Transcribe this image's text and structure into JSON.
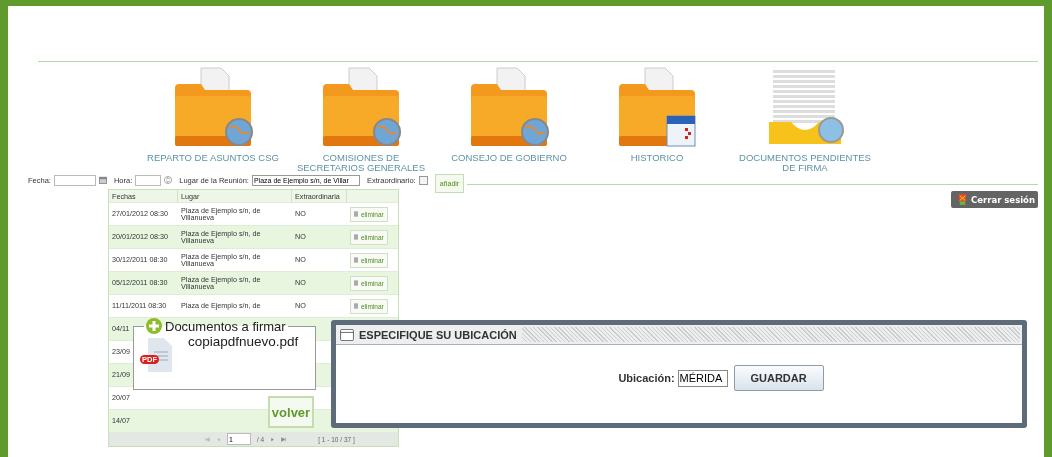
{
  "nav": [
    {
      "label": "REPARTO DE ASUNTOS CSG"
    },
    {
      "label": "COMISIONES DE SECRETARIOS GENERALES"
    },
    {
      "label": "CONSEJO DE GOBIERNO"
    },
    {
      "label": "HISTORICO"
    },
    {
      "label": "DOCUMENTOS PENDIENTES DE FIRMA"
    }
  ],
  "form": {
    "fecha_label": "Fecha:",
    "hora_label": "Hora:",
    "lugar_label": "Lugar de la Reunión:",
    "lugar_value": "Plaza de Ejemplo s/n, de Villar",
    "extra_label": "Extraordinario:",
    "extra_checked": false,
    "add_button": "añadir"
  },
  "logout_button": "Cerrar sesión",
  "table": {
    "columns": [
      "Fechas",
      "Lugar",
      "Extraordinaria"
    ],
    "rows": [
      {
        "date": "27/01/2012 08:30",
        "place": "Plaza de Ejemplo s/n, de Villanueva",
        "extra": "NO",
        "action": "eliminar"
      },
      {
        "date": "20/01/2012 08:30",
        "place": "Plaza de Ejemplo s/n, de Villanueva",
        "extra": "NO",
        "action": "eliminar"
      },
      {
        "date": "30/12/2011 08:30",
        "place": "Plaza de Ejemplo s/n, de Villanueva",
        "extra": "NO",
        "action": "eliminar"
      },
      {
        "date": "05/12/2011 08:30",
        "place": "Plaza de Ejemplo s/n, de Villanueva",
        "extra": "NO",
        "action": "eliminar"
      },
      {
        "date": "11/11/2011 08:30",
        "place": "Plaza de Ejemplo s/n, de",
        "extra": "NO",
        "action": "eliminar"
      },
      {
        "date": "04/11"
      },
      {
        "date": "23/09"
      },
      {
        "date": "21/09"
      },
      {
        "date": "20/07"
      },
      {
        "date": "14/07"
      }
    ]
  },
  "pagination": {
    "page": "1",
    "total": "/ 4",
    "range": "[ 1 - 10 / 37 ]"
  },
  "documents_panel": {
    "title": "Documentos a firmar",
    "file": "copiapdfnuevo.pdf",
    "file_badge": "PDF",
    "back_button": "volver"
  },
  "location_dialog": {
    "title": "ESPECIFIQUE SU UBICACIÓN",
    "label": "Ubicación:",
    "value": "MÉRIDA",
    "save_button": "GUARDAR"
  }
}
